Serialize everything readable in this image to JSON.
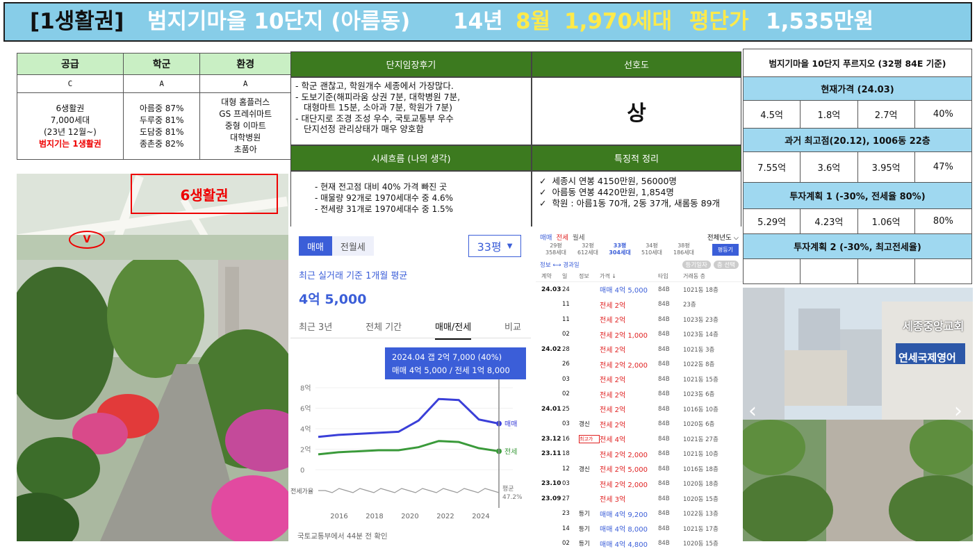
{
  "title": {
    "part1": "[1생활권]",
    "part2": "범지기마을 10단지 (아름동)",
    "part3": "14년",
    "part4": "8월",
    "part5": "1,970세대",
    "part6": "평단가",
    "part7": "1,535만원"
  },
  "supply": {
    "headers": [
      "공급",
      "학군",
      "환경"
    ],
    "grades": [
      "C",
      "A",
      "A"
    ],
    "col1": [
      "6생활권",
      "7,000세대",
      "(23년 12월~)",
      "범지기는 1생활권"
    ],
    "col2": [
      "아름중 87%",
      "두루중 81%",
      "도담중 81%",
      "종촌중 82%"
    ],
    "col3": [
      "대형 홈플러스",
      "GS 프레쉬마트",
      "중형 이마트",
      "대학병원",
      "초품아"
    ]
  },
  "map": {
    "label": "6생활권",
    "marker": "V"
  },
  "review": {
    "header": "단지임장후기",
    "lines": [
      "- 학군 괜찮고, 학원개수 세종에서 가장많다.",
      "- 도보기준(해피라움 상권 7분, 대학병원 7분,",
      "  대형마트 15분, 소아과 7분, 학원가 7분)",
      "- 대단지로 조경 조성 우수, 국토교통부 우수",
      "  단지선정 관리상태가 매우 양호함"
    ]
  },
  "preference": {
    "header": "선호도",
    "value": "상"
  },
  "flow": {
    "header": "시세흐름 (나의 생각)",
    "lines": [
      "- 현재 전고점 대비 40% 가격 빠진 곳",
      "- 매물량 92개로 1970세대수 중 4.6%",
      "- 전세량 31개로 1970세대수 중 1.5%"
    ]
  },
  "features": {
    "header": "특징적 정리",
    "items": [
      "세종시 연봉 4150만원, 56000명",
      "아름동 연봉 4420만원, 1,854명",
      "학원 : 아름1동 70개, 2동 37개, 새롬동 89개"
    ],
    "check": "✓"
  },
  "right": {
    "title": "범지기마을 10단지 푸르지오 (32평 84E 기준)",
    "current_label": "현재가격 (24.03)",
    "current": [
      "4.5억",
      "1.8억",
      "2.7억",
      "40%"
    ],
    "peak_label": "과거 최고점(20.12), 1006동 22층",
    "peak": [
      "7.55억",
      "3.6억",
      "3.95억",
      "47%"
    ],
    "plan1_label": "투자계획 1 (-30%, 전세율 80%)",
    "plan1": [
      "5.29억",
      "4.23억",
      "1.06억",
      "80%"
    ],
    "plan2_label": "투자계획 2 (-30%, 최고전세율)",
    "plan2": [
      "",
      "",
      "",
      ""
    ]
  },
  "widget": {
    "tab_active": "매매",
    "tab_other": "전월세",
    "size": "33평",
    "caption": "최근 실거래 기준 1개월 평균",
    "price": "4억 5,000",
    "tabs": [
      "최근 3년",
      "전체 기간",
      "매매/전세",
      "비교"
    ],
    "tooltip1": "2024.04  갭 2억 7,000 (40%)",
    "tooltip2": "매매 4억 5,000 / 전세 1억 8,000",
    "legend_sale": "매매",
    "legend_rent": "전세",
    "ratio_label": "전세가율",
    "ratio_avg": "평균",
    "ratio_val": "47.2%",
    "source": "국토교통부에서 44분 전 확인"
  },
  "chart_data": {
    "type": "line",
    "x": [
      "2015",
      "2016",
      "2017",
      "2018",
      "2019",
      "2020",
      "2021",
      "2022",
      "2023",
      "2024"
    ],
    "yticks": [
      "0",
      "2억",
      "4억",
      "6억",
      "8억"
    ],
    "xticks": [
      "2016",
      "2018",
      "2020",
      "2022",
      "2024"
    ],
    "ylim": [
      0,
      8
    ],
    "series": [
      {
        "name": "매매",
        "values": [
          3.2,
          3.4,
          3.5,
          3.6,
          3.7,
          4.8,
          6.9,
          6.8,
          4.9,
          4.5
        ]
      },
      {
        "name": "전세",
        "values": [
          1.5,
          1.7,
          1.8,
          1.9,
          1.9,
          2.2,
          2.8,
          2.7,
          2.1,
          1.8
        ]
      }
    ]
  },
  "deals": {
    "tabs": [
      "매매",
      "전세",
      "월세"
    ],
    "all_years": "전체년도 ⌵",
    "sizes": [
      [
        "29평",
        "358세대"
      ],
      [
        "32평",
        "612세대"
      ],
      [
        "33평",
        "304세대"
      ],
      [
        "34평",
        "510세대"
      ],
      [
        "38평",
        "186세대"
      ]
    ],
    "dong_btn": "평등기",
    "info": "정보 ⟷ 경과일",
    "btn1": "등기일자",
    "btn2": "층 선택",
    "cols": [
      "계약",
      "일",
      "정보",
      "가격 ↓",
      "타입",
      "거래동 층"
    ],
    "rows": [
      [
        "24.03",
        "24",
        "",
        "매매 4억 5,000",
        "84B",
        "1021동 18층"
      ],
      [
        "",
        "11",
        "",
        "전세 2억",
        "84B",
        "23층"
      ],
      [
        "",
        "11",
        "",
        "전세 2억",
        "84B",
        "1023동 23층"
      ],
      [
        "",
        "02",
        "",
        "전세 2억 1,000",
        "84B",
        "1023동 14층"
      ],
      [
        "24.02",
        "28",
        "",
        "전세 2억",
        "84B",
        "1021동 3층"
      ],
      [
        "",
        "26",
        "",
        "전세 2억 2,000",
        "84B",
        "1022동 8층"
      ],
      [
        "",
        "03",
        "",
        "전세 2억",
        "84B",
        "1021동 15층"
      ],
      [
        "",
        "02",
        "",
        "전세 2억",
        "84B",
        "1023동 6층"
      ],
      [
        "24.01",
        "25",
        "",
        "전세 2억",
        "84B",
        "1016동 10층"
      ],
      [
        "",
        "03",
        "갱신",
        "전세 2억",
        "84B",
        "1020동 6층"
      ],
      [
        "23.12",
        "16",
        "최고가",
        "전세 4억",
        "84B",
        "1021동 27층"
      ],
      [
        "23.11",
        "18",
        "",
        "전세 2억 2,000",
        "84B",
        "1021동 10층"
      ],
      [
        "",
        "12",
        "갱신",
        "전세 2억 5,000",
        "84B",
        "1016동 18층"
      ],
      [
        "23.10",
        "03",
        "",
        "전세 2억 2,000",
        "84B",
        "1020동 18층"
      ],
      [
        "23.09",
        "27",
        "",
        "전세 3억",
        "84B",
        "1020동 15층"
      ],
      [
        "",
        "23",
        "등기",
        "매매 4억 9,200",
        "84B",
        "1022동 13층"
      ],
      [
        "",
        "14",
        "등기",
        "매매 4억 8,000",
        "84B",
        "1021동 17층"
      ],
      [
        "",
        "02",
        "등기",
        "매매 4억 4,800",
        "84B",
        "1020동 15층"
      ]
    ]
  },
  "photo_right": {
    "sign1": "세종중앙교회",
    "sign2": "연세국제영어"
  },
  "colors": {
    "header_green": "#3c7a1f",
    "title_bg": "#87cde8",
    "blue": "#3a3fd8",
    "green": "#3a9a3a",
    "accent": "#3b5ed8"
  }
}
